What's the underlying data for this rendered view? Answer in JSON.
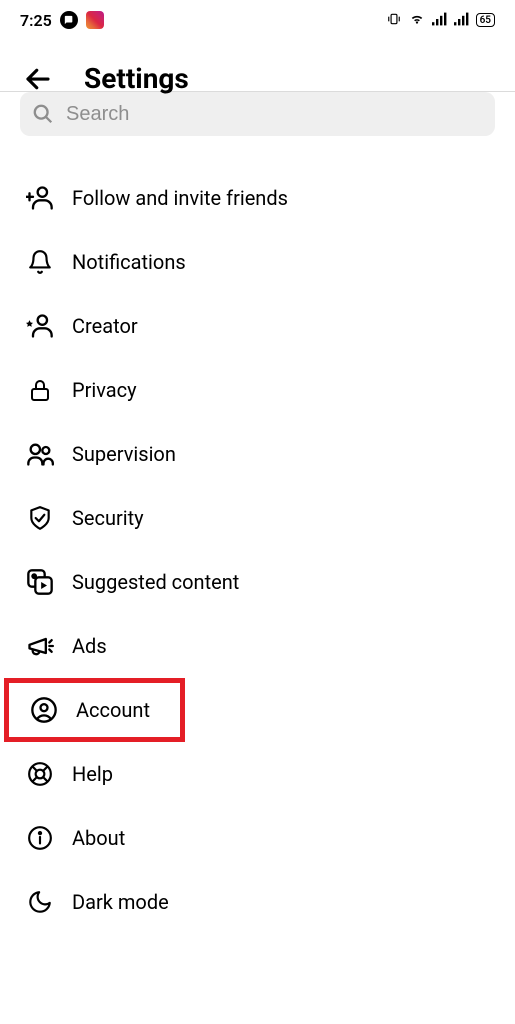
{
  "status_bar": {
    "time": "7:25",
    "battery": "65"
  },
  "header": {
    "title": "Settings"
  },
  "search": {
    "placeholder": "Search"
  },
  "menu": {
    "items": [
      {
        "label": "Follow and invite friends",
        "icon": "person-plus-icon"
      },
      {
        "label": "Notifications",
        "icon": "bell-icon"
      },
      {
        "label": "Creator",
        "icon": "person-star-icon"
      },
      {
        "label": "Privacy",
        "icon": "lock-icon"
      },
      {
        "label": "Supervision",
        "icon": "people-icon"
      },
      {
        "label": "Security",
        "icon": "shield-check-icon"
      },
      {
        "label": "Suggested content",
        "icon": "media-icon"
      },
      {
        "label": "Ads",
        "icon": "megaphone-icon"
      },
      {
        "label": "Account",
        "icon": "user-circle-icon",
        "highlighted": true
      },
      {
        "label": "Help",
        "icon": "lifebuoy-icon"
      },
      {
        "label": "About",
        "icon": "info-icon"
      },
      {
        "label": "Dark mode",
        "icon": "moon-icon"
      }
    ]
  }
}
